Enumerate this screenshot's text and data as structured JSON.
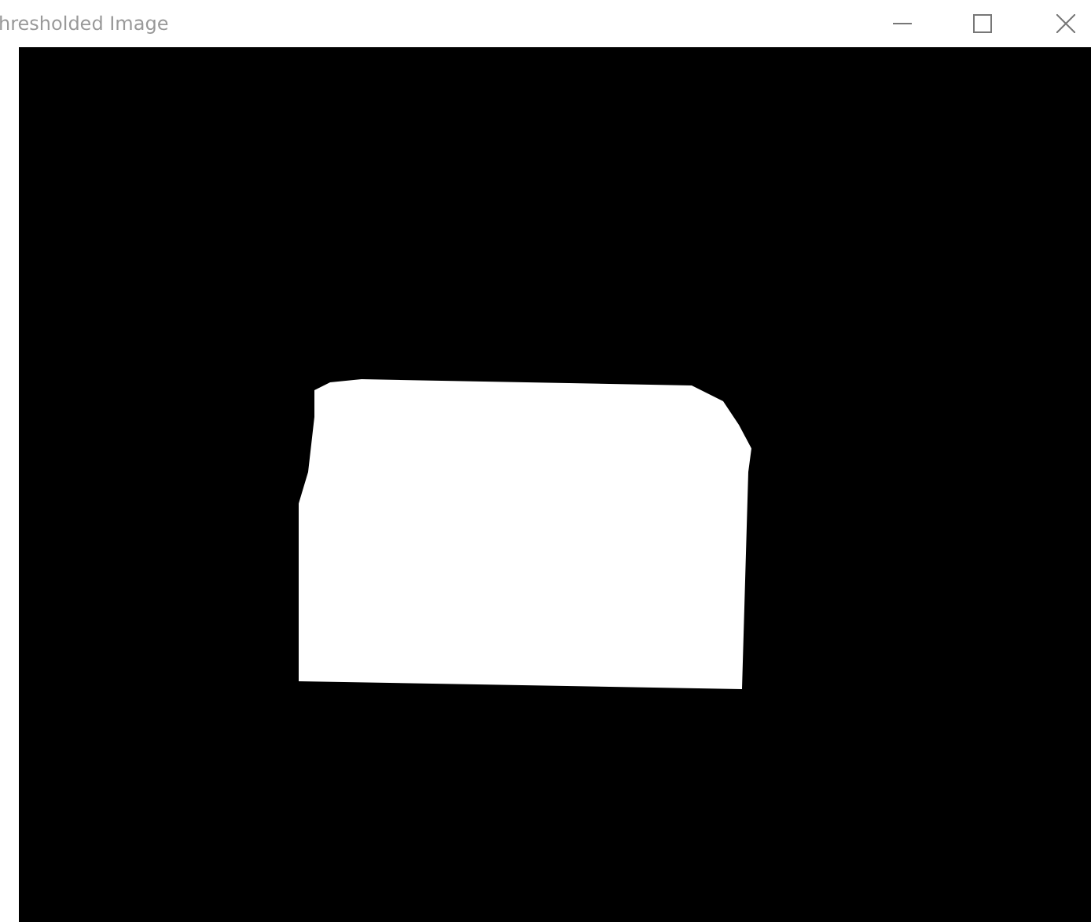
{
  "window": {
    "title": "hresholded Image"
  }
}
